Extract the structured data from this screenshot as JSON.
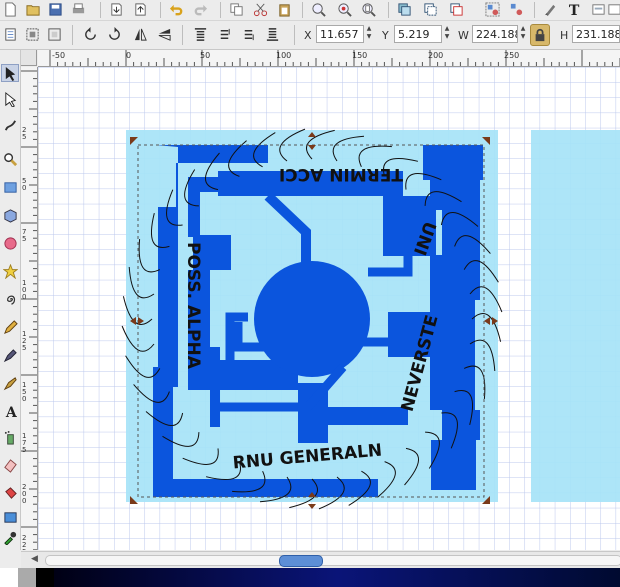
{
  "toolbar_top": {
    "icons": [
      "new-document-icon",
      "open-icon",
      "save-icon",
      "print-icon",
      "import-icon",
      "export-icon",
      "undo-icon",
      "redo-icon",
      "copy-icon",
      "cut-icon",
      "paste-icon",
      "zoom-selection-icon",
      "zoom-drawing-icon",
      "zoom-page-icon",
      "duplicate-icon",
      "clone-icon",
      "unlink-clone-icon",
      "group-icon",
      "ungroup-icon",
      "fill-stroke-icon",
      "text-font-icon",
      "preferences-icon",
      "document-properties-icon"
    ]
  },
  "toolbar_select": {
    "x_label": "X",
    "x_value": "11.657",
    "y_label": "Y",
    "y_value": "5.219",
    "w_label": "W",
    "w_value": "224.188",
    "h_label": "H",
    "h_value": "231.188"
  },
  "ruler": {
    "h_labels": [
      "-50",
      "0",
      "50",
      "100",
      "150",
      "200",
      "250"
    ],
    "v_labels": [
      "2\n5",
      "5\n0",
      "7\n5",
      "1\n0\n0",
      "1\n2\n5",
      "1\n5\n0",
      "1\n7\n5",
      "2\n0\n0",
      "2\n2\n5"
    ]
  },
  "canvas": {
    "text_top": "TERMIN ACCI",
    "text_right_top": "UNI",
    "text_right": "NEVERSTE",
    "text_bottom": "RNU GENERALN",
    "text_left": "POSS. ALPHA",
    "colors": {
      "background": "#a6e3f7",
      "trace": "#0b55dd",
      "grid": "#b9c7ee"
    }
  },
  "tools": [
    "selector-tool-icon",
    "node-tool-icon",
    "tweak-tool-icon",
    "zoom-tool-icon",
    "rectangle-tool-icon",
    "3d-box-tool-icon",
    "ellipse-tool-icon",
    "star-tool-icon",
    "spiral-tool-icon",
    "pencil-tool-icon",
    "pen-tool-icon",
    "calligraphy-tool-icon",
    "text-tool-icon",
    "spray-tool-icon",
    "eraser-tool-icon",
    "bucket-tool-icon",
    "gradient-tool-icon",
    "dropper-tool-icon"
  ]
}
